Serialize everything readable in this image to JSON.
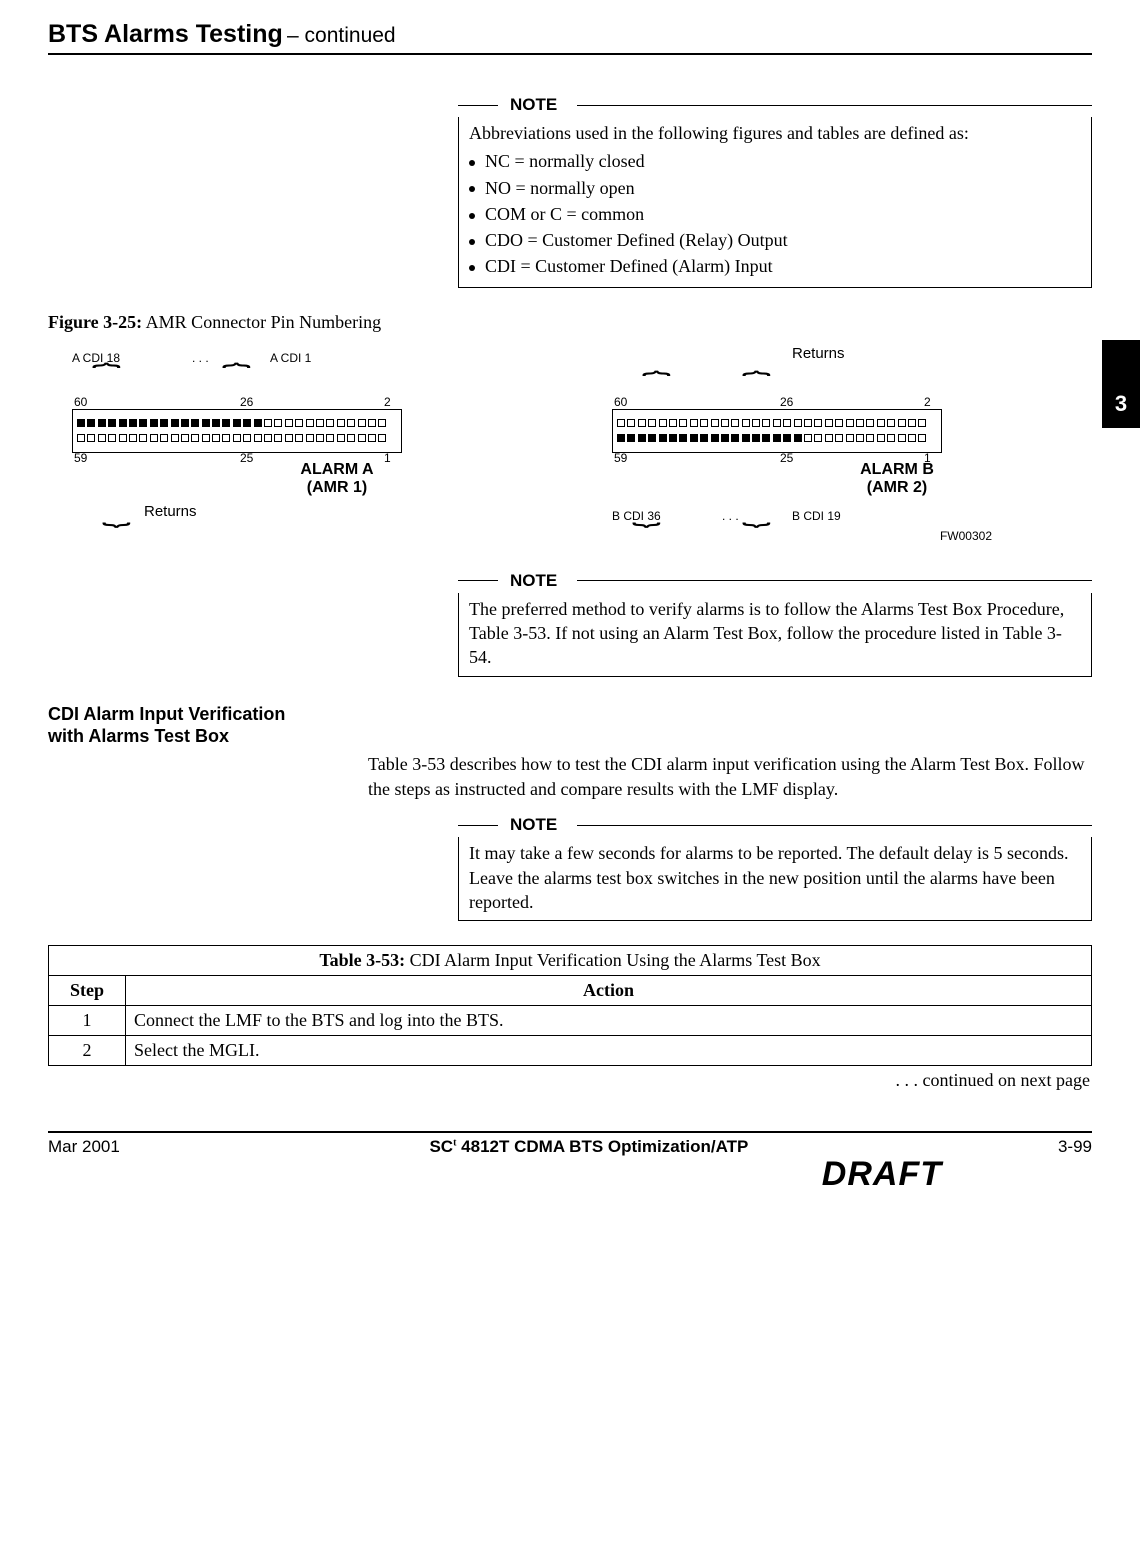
{
  "header": {
    "title": "BTS Alarms Testing",
    "sub": " – continued"
  },
  "side_tab": "3",
  "note1": {
    "label": "NOTE",
    "lead": "Abbreviations used in the following figures and tables are defined as:",
    "items": [
      "NC = normally closed",
      "NO = normally open",
      "COM or C = common",
      "CDO = Customer Defined (Relay) Output",
      "CDI = Customer Defined (Alarm) Input"
    ]
  },
  "figure": {
    "label": "Figure 3-25:",
    "caption": "AMR Connector Pin Numbering"
  },
  "diagram": {
    "left": {
      "top_left_lbl": "A CDI 18",
      "top_mid_lbl": ". . .",
      "top_right_lbl": "A CDI 1",
      "pins": {
        "tl": "60",
        "tm": "26",
        "tr": "2",
        "bl": "59",
        "bm": "25",
        "br": "1"
      },
      "returns": "Returns",
      "alarm_line1": "ALARM A",
      "alarm_line2": "(AMR 1)"
    },
    "right": {
      "returns": "Returns",
      "pins": {
        "tl": "60",
        "tm": "26",
        "tr": "2",
        "bl": "59",
        "bm": "25",
        "br": "1"
      },
      "bot_left_lbl": "B CDI 36",
      "bot_mid_lbl": ". . .",
      "bot_right_lbl": "B CDI 19",
      "alarm_line1": "ALARM B",
      "alarm_line2": "(AMR 2)",
      "figcode": "FW00302"
    }
  },
  "note2": {
    "label": "NOTE",
    "body": "The preferred method to verify alarms is to follow the Alarms Test Box Procedure, Table 3-53. If not using an Alarm Test Box, follow the procedure listed in Table 3-54."
  },
  "section": {
    "heading_line1": "CDI Alarm Input Verification",
    "heading_line2": "with Alarms Test Box",
    "para": "Table 3-53 describes how to test the CDI alarm input verification using the Alarm Test Box. Follow the steps as instructed and compare results with the LMF display."
  },
  "note3": {
    "label": "NOTE",
    "body": "It may take a few seconds for alarms to be reported. The default delay is 5 seconds. Leave the alarms test box switches in the new position until the alarms have been reported."
  },
  "table": {
    "title_label": "Table 3-53:",
    "title_text": "CDI Alarm Input Verification Using the Alarms Test Box",
    "col_step": "Step",
    "col_action": "Action",
    "rows": [
      {
        "step": "1",
        "action": "Connect the LMF to the BTS and log into the BTS."
      },
      {
        "step": "2",
        "action": "Select the MGLI."
      }
    ],
    "continued": ". . . continued on next page"
  },
  "footer": {
    "left": "Mar 2001",
    "mid_pre": "SC",
    "mid_tm": "t",
    "mid_post": "4812T CDMA BTS Optimization/ATP",
    "right": "3-99",
    "draft": "DRAFT"
  }
}
